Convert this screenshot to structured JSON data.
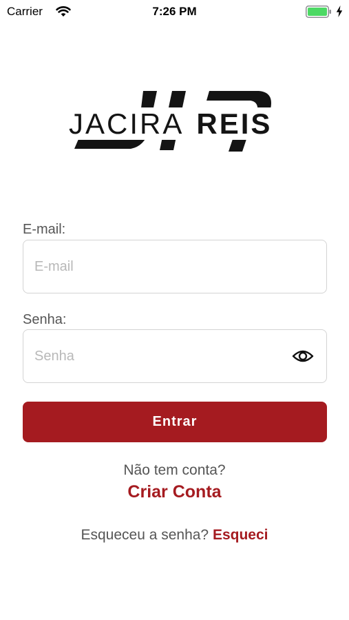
{
  "status_bar": {
    "carrier": "Carrier",
    "time": "7:26 PM",
    "battery_color": "#4cd964"
  },
  "logo": {
    "first_name": "JACIRA",
    "last_name": "REIS"
  },
  "form": {
    "email": {
      "label": "E-mail:",
      "placeholder": "E-mail",
      "value": ""
    },
    "password": {
      "label": "Senha:",
      "placeholder": "Senha",
      "value": "",
      "toggle_icon": "eye-icon"
    },
    "submit_label": "Entrar"
  },
  "signup": {
    "prompt": "Não tem conta?",
    "link_label": "Criar Conta"
  },
  "forgot": {
    "prompt": "Esqueceu a senha?",
    "link_label": "Esqueci"
  },
  "colors": {
    "accent": "#a51b20",
    "label_text": "#555555",
    "input_border": "#d3d3d3"
  }
}
